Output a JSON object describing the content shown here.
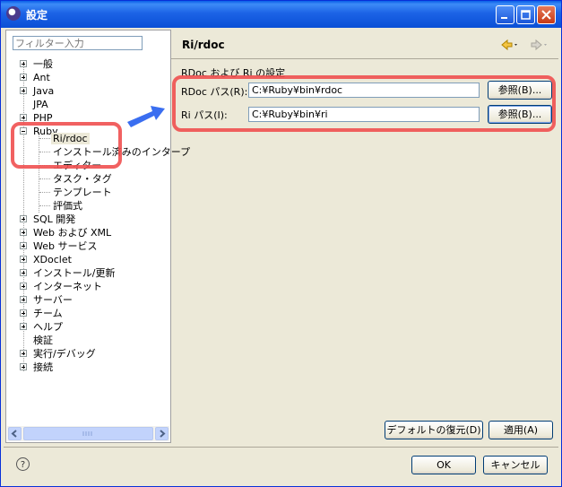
{
  "window": {
    "title": "設定"
  },
  "left": {
    "filter_placeholder": "フィルター入力",
    "tree": [
      {
        "label": "一般"
      },
      {
        "label": "Ant"
      },
      {
        "label": "Java"
      },
      {
        "label": "JPA"
      },
      {
        "label": "PHP"
      },
      {
        "label": "Ruby"
      },
      {
        "label": "Ri/rdoc"
      },
      {
        "label": "インストール済みのインタープ"
      },
      {
        "label": "エディター"
      },
      {
        "label": "タスク・タグ"
      },
      {
        "label": "テンプレート"
      },
      {
        "label": "評価式"
      },
      {
        "label": "SQL 開発"
      },
      {
        "label": "Web および XML"
      },
      {
        "label": "Web サービス"
      },
      {
        "label": "XDoclet"
      },
      {
        "label": "インストール/更新"
      },
      {
        "label": "インターネット"
      },
      {
        "label": "サーバー"
      },
      {
        "label": "チーム"
      },
      {
        "label": "ヘルプ"
      },
      {
        "label": "検証"
      },
      {
        "label": "実行/デバッグ"
      },
      {
        "label": "接続"
      }
    ]
  },
  "right": {
    "page_title": "Ri/rdoc",
    "group_label": "RDoc および Ri の設定",
    "rdoc_label": "RDoc パス(R):",
    "rdoc_value": "C:¥Ruby¥bin¥rdoc",
    "ri_label": "Ri パス(I):",
    "ri_value": "C:¥Ruby¥bin¥ri",
    "browse_label": "参照(B)...",
    "restore_defaults": "デフォルトの復元(D)",
    "apply": "適用(A)"
  },
  "footer": {
    "help": "?",
    "ok": "OK",
    "cancel": "キャンセル"
  },
  "colors": {
    "highlight": "#f05050",
    "arrow": "#3a6ef0",
    "title_bar": "#0a4fd6"
  }
}
